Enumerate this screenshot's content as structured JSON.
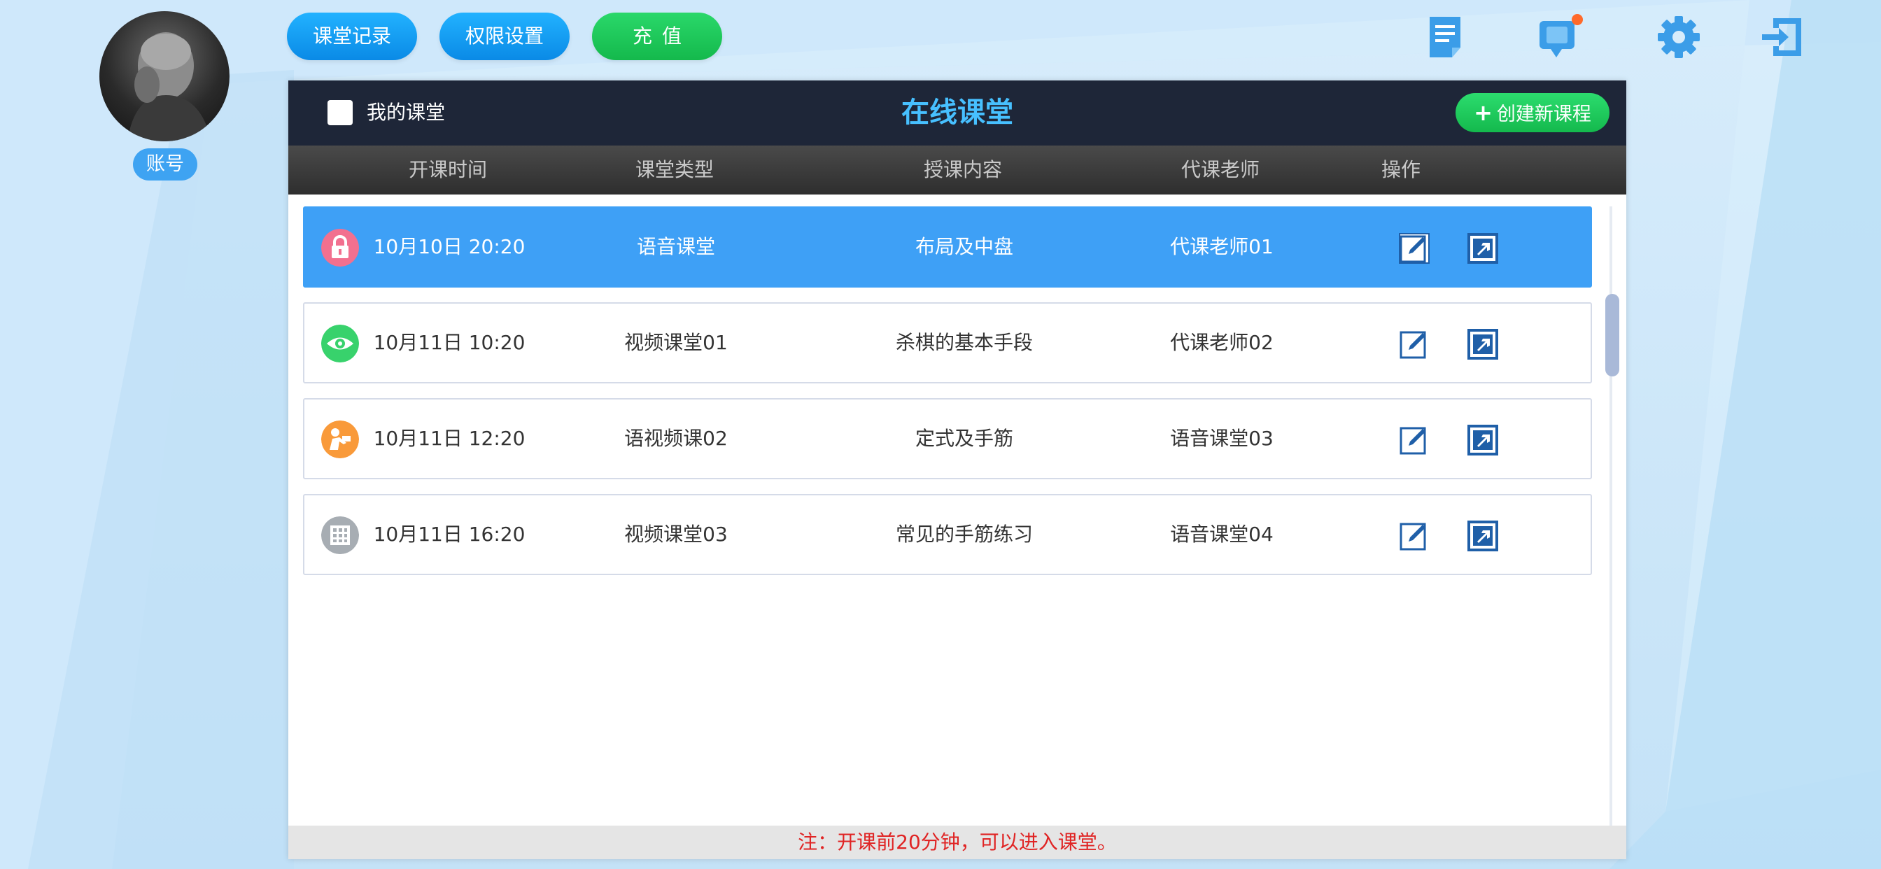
{
  "sidebar": {
    "account_label": "账号"
  },
  "toolbar": {
    "class_record": "课堂记录",
    "permission": "权限设置",
    "recharge": "充值"
  },
  "header_icons": [
    "notes-icon",
    "message-icon",
    "settings-icon",
    "logout-icon"
  ],
  "panel": {
    "my_class_label": "我的课堂",
    "title": "在线课堂",
    "create_label": "创建新课程",
    "columns": [
      "开课时间",
      "课堂类型",
      "授课内容",
      "代课老师",
      "操作"
    ],
    "rows": [
      {
        "status": "lock-icon",
        "time": "10月10日  20:20",
        "type": "语音课堂",
        "content": "布局及中盘",
        "teacher": "代课老师01",
        "selected": true
      },
      {
        "status": "eye-icon",
        "time": "10月11日  10:20",
        "type": "视频课堂01",
        "content": "杀棋的基本手段",
        "teacher": "代课老师02",
        "selected": false
      },
      {
        "status": "person-icon",
        "time": "10月11日  12:20",
        "type": "语视频课02",
        "content": "定式及手筋",
        "teacher": "语音课堂03",
        "selected": false
      },
      {
        "status": "board-icon",
        "time": "10月11日  16:20",
        "type": "视频课堂03",
        "content": "常见的手筋练习",
        "teacher": "语音课堂04",
        "selected": false
      }
    ],
    "note": "注：开课前20分钟，可以进入课堂。"
  },
  "colors": {
    "accent_blue": "#3ea0f6",
    "title_blue": "#47c0ff",
    "green": "#1fc95b",
    "header_dark": "#1e2638",
    "note_red": "#e02424",
    "status_lock": "#f2708f",
    "status_eye": "#38d26c",
    "status_person": "#f99a3a",
    "status_board": "#a7adb3"
  }
}
